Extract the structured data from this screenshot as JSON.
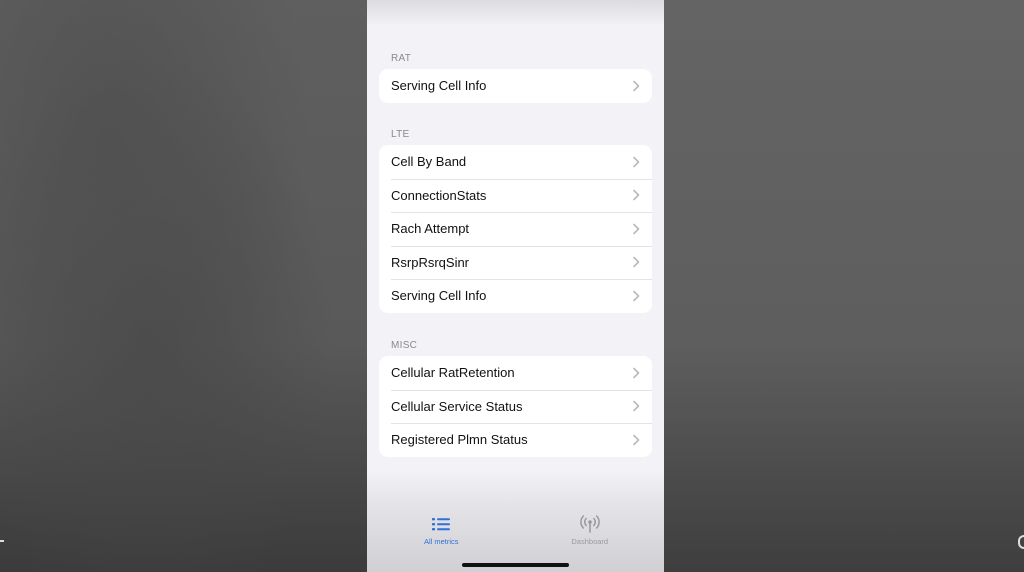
{
  "sections": [
    {
      "header": "RAT",
      "items": [
        {
          "label": "Serving Cell Info"
        }
      ]
    },
    {
      "header": "LTE",
      "items": [
        {
          "label": "Cell By Band"
        },
        {
          "label": "ConnectionStats"
        },
        {
          "label": "Rach Attempt"
        },
        {
          "label": "RsrpRsrqSinr"
        },
        {
          "label": "Serving Cell Info"
        }
      ]
    },
    {
      "header": "MISC",
      "items": [
        {
          "label": "Cellular RatRetention"
        },
        {
          "label": "Cellular Service Status"
        },
        {
          "label": "Registered Plmn Status"
        }
      ]
    }
  ],
  "tabbar": {
    "tabs": [
      {
        "label": "All metrics",
        "icon": "list-icon",
        "active": true
      },
      {
        "label": "Dashboard",
        "icon": "antenna-icon",
        "active": false
      }
    ]
  },
  "colors": {
    "accent": "#2f6fd6",
    "background": "#f2f2f7",
    "cell": "#ffffff",
    "secondary_text": "#8a8a8e"
  }
}
